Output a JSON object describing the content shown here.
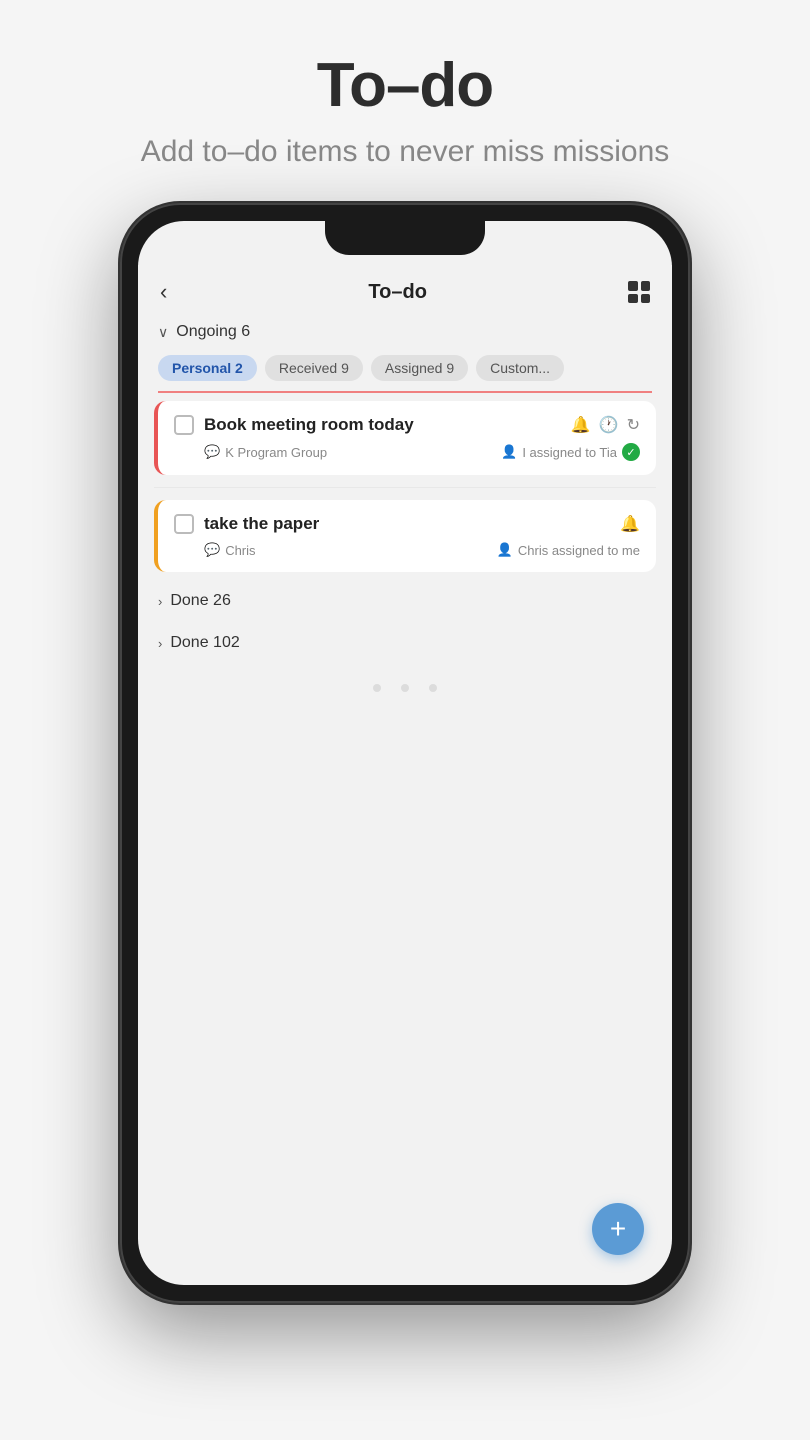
{
  "header": {
    "title": "To–do",
    "subtitle": "Add to–do items to never\nmiss missions"
  },
  "app": {
    "screen_title": "To–do",
    "back_label": "‹",
    "ongoing_label": "Ongoing 6",
    "filter_tabs": [
      {
        "label": "Personal 2",
        "active": true
      },
      {
        "label": "Received 9",
        "active": false
      },
      {
        "label": "Assigned 9",
        "active": false
      },
      {
        "label": "Custom...",
        "active": false
      }
    ],
    "tasks": [
      {
        "title": "Book meeting room today",
        "group": "K Program Group",
        "assign": "I assigned to Tia",
        "urgent": true,
        "has_check": true,
        "completed": false
      },
      {
        "title": "take the paper",
        "group": "Chris",
        "assign": "Chris assigned to me",
        "urgent": false,
        "has_check": true,
        "completed": false
      }
    ],
    "done_sections": [
      {
        "label": "Done 26"
      },
      {
        "label": "Done 102"
      }
    ],
    "fab_label": "+"
  }
}
